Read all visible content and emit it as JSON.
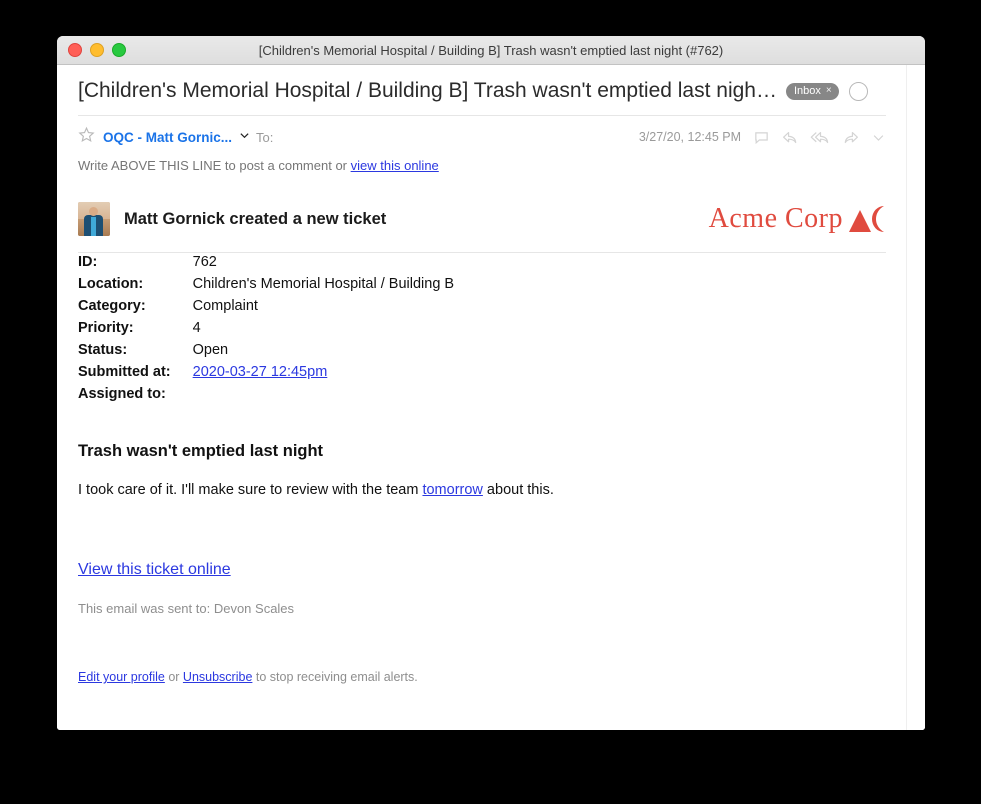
{
  "window": {
    "title": "[Children's Memorial Hospital / Building B] Trash wasn't emptied last night (#762)",
    "traffic_lights": {
      "close": "close-button",
      "minimize": "minimize-button",
      "maximize": "maximize-button"
    }
  },
  "message": {
    "subject": "[Children's Memorial Hospital / Building B] Trash wasn't emptied last nigh…",
    "label_badge": "Inbox",
    "label_badge_remove": "×",
    "sender": "OQC - Matt Gornic...",
    "to_label": "To:",
    "timestamp": "3/27/20, 12:45 PM",
    "actions": [
      "comment-icon",
      "reply-icon",
      "reply-all-icon",
      "forward-icon",
      "more-icon"
    ],
    "above_line_prefix": "Write ABOVE THIS LINE to post a comment or ",
    "above_line_link": "view this online"
  },
  "email": {
    "creator_line": "Matt Gornick created a new ticket",
    "brand_name": "Acme Corp",
    "fields": [
      {
        "key": "ID:",
        "value": "762",
        "link": false
      },
      {
        "key": "Location:",
        "value": "Children's Memorial Hospital / Building B",
        "link": false
      },
      {
        "key": "Category:",
        "value": "Complaint",
        "link": false
      },
      {
        "key": "Priority:",
        "value": "4",
        "link": false
      },
      {
        "key": "Status:",
        "value": "Open",
        "link": false
      },
      {
        "key": "Submitted at:",
        "value": "2020-03-27 12:45pm",
        "link": true
      },
      {
        "key": "Assigned to:",
        "value": "",
        "link": false
      }
    ],
    "ticket_title": "Trash wasn't emptied last night",
    "body_before_link": "I took care of it. I'll make sure to review with the team ",
    "body_link": "tomorrow",
    "body_after_link": " about this.",
    "view_ticket_link": "View this ticket online",
    "sent_to": "This email was sent to: Devon Scales",
    "footer_edit_link": "Edit your profile",
    "footer_or": " or ",
    "footer_unsub_link": "Unsubscribe",
    "footer_tail": " to stop receiving email alerts."
  },
  "colors": {
    "link": "#2b38e0",
    "sender_blue": "#1a73e8",
    "brand_red": "#e04b3f",
    "badge_gray": "#878787",
    "muted": "#8e8e8e"
  }
}
